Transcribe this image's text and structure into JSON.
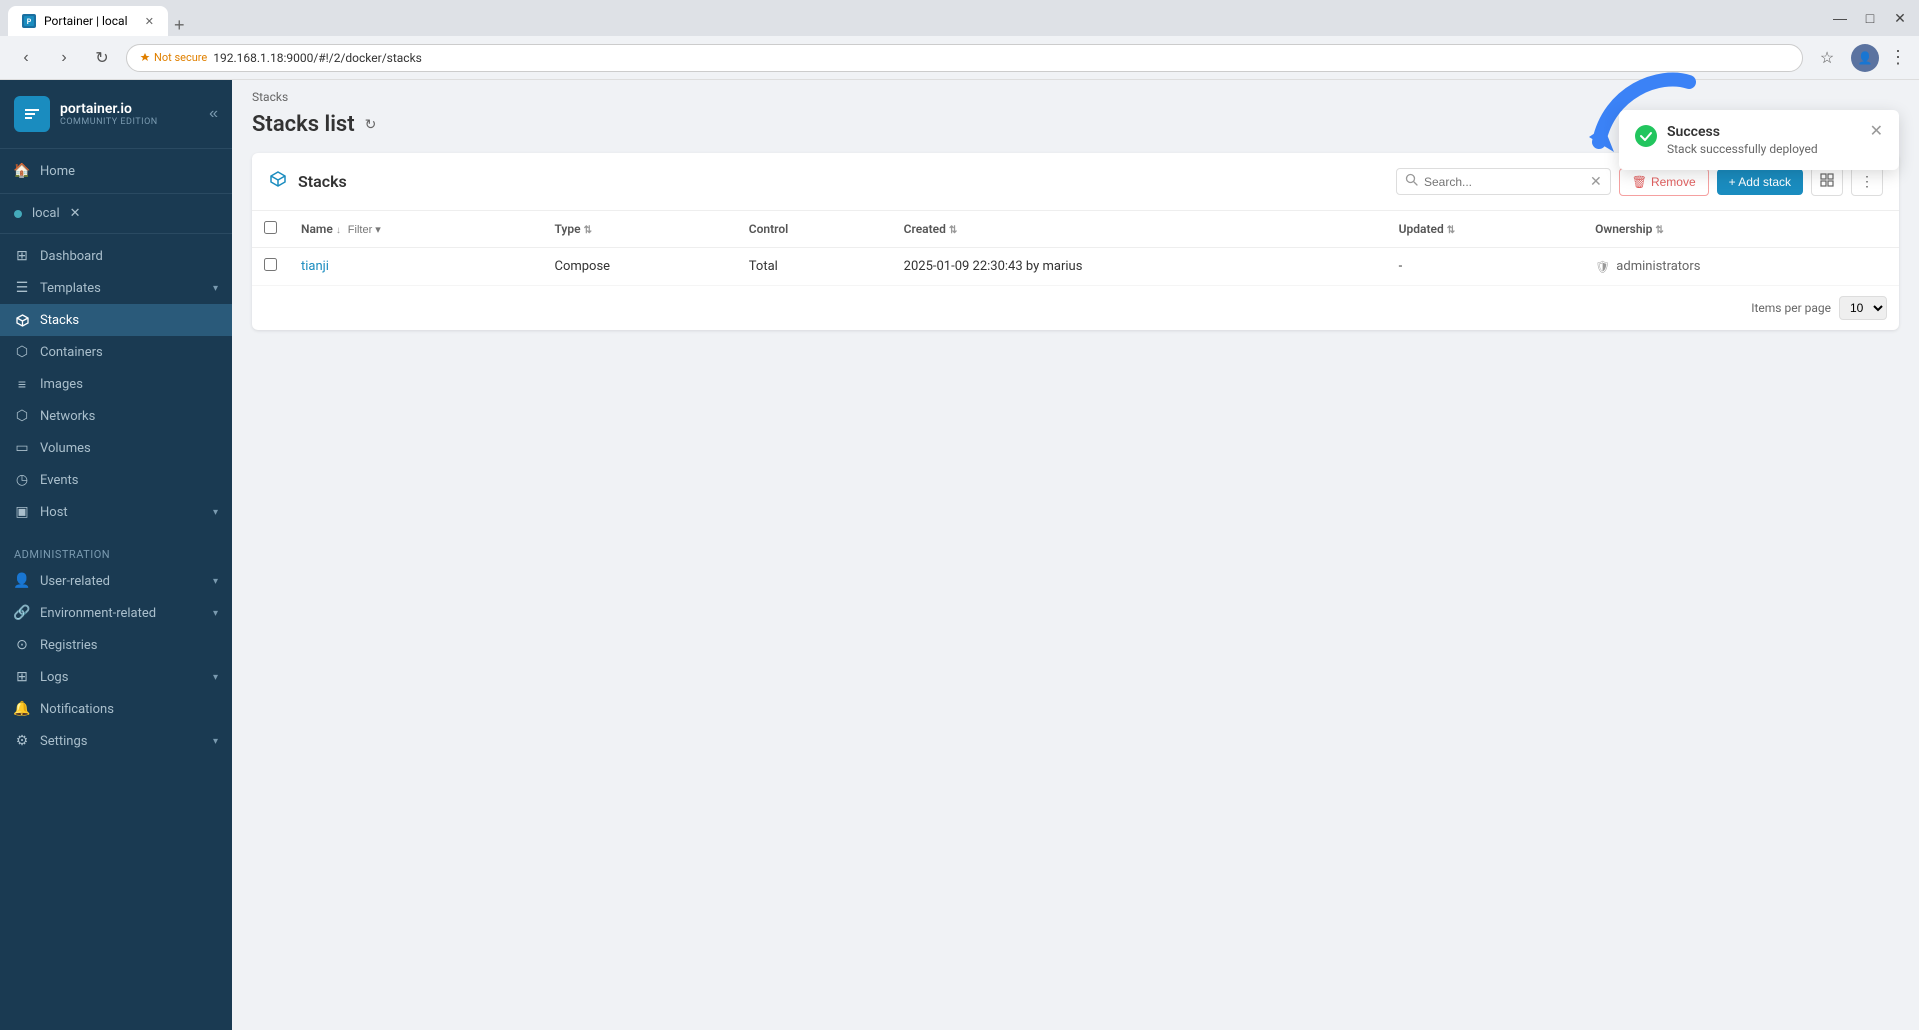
{
  "browser": {
    "tab_title": "Portainer | local",
    "url": "192.168.1.18:9000/#!/2/docker/stacks",
    "not_secure_label": "Not secure",
    "new_tab_symbol": "+",
    "favicon_letter": "P"
  },
  "sidebar": {
    "logo_name": "portainer.io",
    "logo_edition": "COMMUNITY EDITION",
    "home_label": "Home",
    "env_name": "local",
    "dashboard_label": "Dashboard",
    "templates_label": "Templates",
    "stacks_label": "Stacks",
    "containers_label": "Containers",
    "images_label": "Images",
    "networks_label": "Networks",
    "volumes_label": "Volumes",
    "events_label": "Events",
    "host_label": "Host",
    "admin_section": "Administration",
    "user_related_label": "User-related",
    "env_related_label": "Environment-related",
    "registries_label": "Registries",
    "logs_label": "Logs",
    "notifications_label": "Notifications",
    "settings_label": "Settings"
  },
  "page": {
    "breadcrumb": "Stacks",
    "title": "Stacks list"
  },
  "card": {
    "title": "Stacks",
    "search_placeholder": "Search...",
    "remove_label": "Remove",
    "add_stack_label": "+ Add stack"
  },
  "table": {
    "columns": [
      "Name",
      "Filter",
      "Type",
      "Control",
      "Created",
      "Updated",
      "Ownership"
    ],
    "rows": [
      {
        "name": "tianji",
        "type": "Compose",
        "control": "Total",
        "created": "2025-01-09 22:30:43 by marius",
        "updated": "-",
        "ownership": "administrators"
      }
    ],
    "items_per_page_label": "Items per page",
    "items_per_page_value": "10"
  },
  "toast": {
    "status": "Success",
    "message": "Stack successfully deployed",
    "icon": "✓"
  }
}
